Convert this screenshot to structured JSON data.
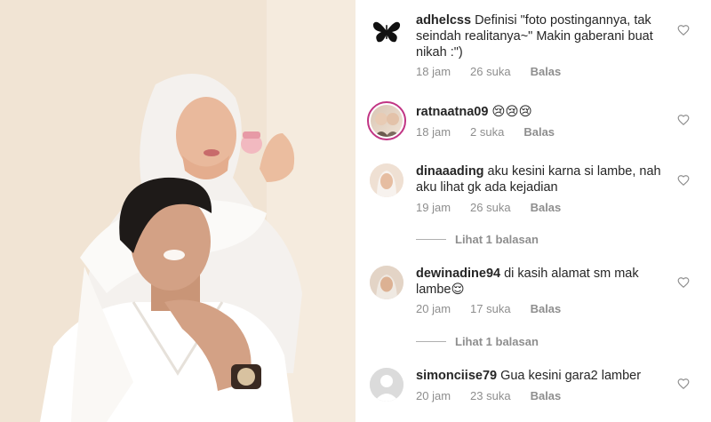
{
  "comments": [
    {
      "username": "adhelcss",
      "text": "Definisi \"foto postingannya, tak seindah realitanya~\" Makin gaberani buat nikah :\")",
      "time": "18 jam",
      "likes": "26 suka",
      "reply": "Balas",
      "avatar_icon": "butterfly-icon"
    },
    {
      "username": "ratnaatna09",
      "text": "😢😢😢",
      "time": "18 jam",
      "likes": "2 suka",
      "reply": "Balas"
    },
    {
      "username": "dinaaading",
      "text": "aku kesini karna si lambe, nah aku lihat gk ada kejadian",
      "time": "19 jam",
      "likes": "26 suka",
      "reply": "Balas",
      "view_replies": "Lihat 1 balasan"
    },
    {
      "username": "dewinadine94",
      "text": "di kasih alamat sm mak lambe😌",
      "time": "20 jam",
      "likes": "17 suka",
      "reply": "Balas",
      "view_replies": "Lihat 1 balasan"
    },
    {
      "username": "simonciise79",
      "text": "Gua kesini gara2 lamber",
      "time": "20 jam",
      "likes": "23 suka",
      "reply": "Balas"
    }
  ],
  "colors": {
    "text": "#262626",
    "muted": "#8e8e8e",
    "story_ring": "#c13584"
  }
}
